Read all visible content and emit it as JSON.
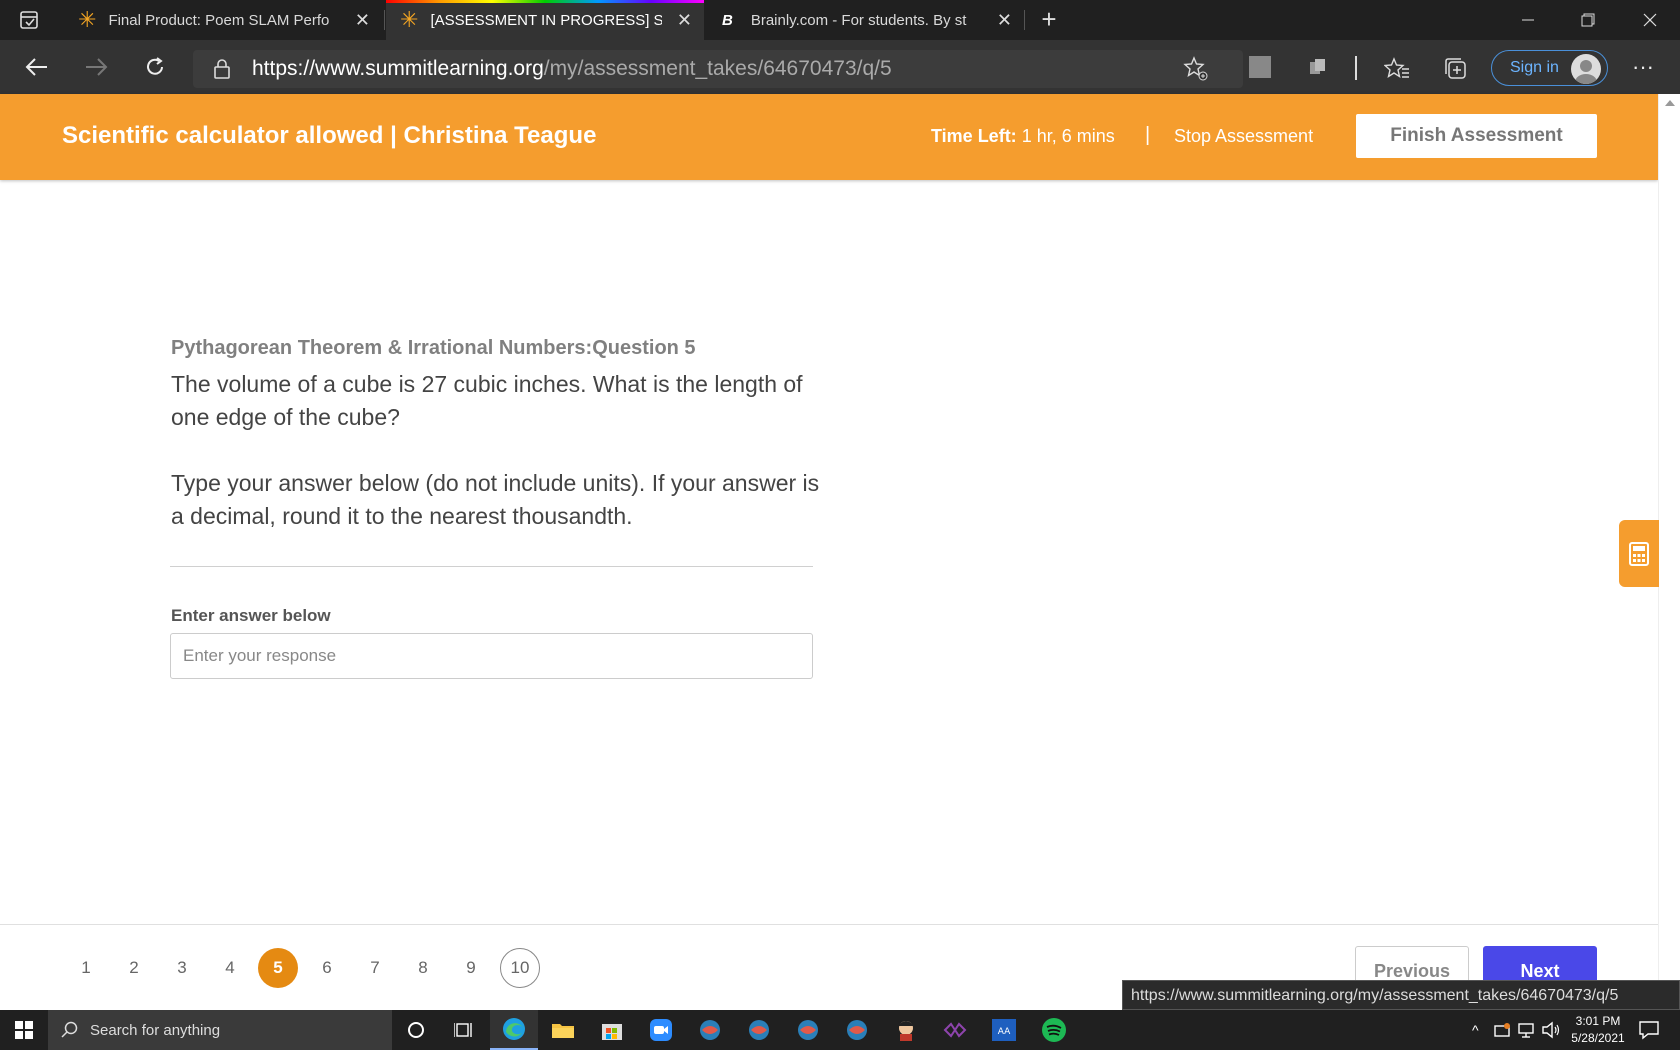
{
  "browser": {
    "tabs": [
      {
        "title": "Final Product: Poem SLAM Perfo",
        "active": false
      },
      {
        "title": "[ASSESSMENT IN PROGRESS] Su",
        "active": true
      },
      {
        "title": "Brainly.com - For students. By st",
        "active": false
      }
    ],
    "url_host": "https://www.summitlearning.org",
    "url_path": "/my/assessment_takes/64670473/q/5",
    "signin_label": "Sign in",
    "status_url": "https://www.summitlearning.org/my/assessment_takes/64670473/q/5"
  },
  "header": {
    "title": "Scientific calculator allowed | Christina Teague",
    "time_left_label": "Time Left:",
    "time_left_value": " 1 hr, 6 mins",
    "separator": "|",
    "stop_label": "Stop Assessment",
    "finish_label": "Finish Assessment",
    "accent_color": "#f59d2e"
  },
  "question": {
    "heading": "Pythagorean Theorem & Irrational Numbers:Question 5",
    "prompt": "The volume of a cube is 27 cubic inches. What is the length of one edge of the cube?",
    "instructions": "Type your answer below (do not include units). If your answer is a decimal, round it to the nearest thousandth.",
    "answer_label": "Enter answer below",
    "answer_placeholder": "Enter your response",
    "answer_value": ""
  },
  "pagination": {
    "items": [
      "1",
      "2",
      "3",
      "4",
      "5",
      "6",
      "7",
      "8",
      "9",
      "10"
    ],
    "current": "5",
    "previous_label": "Previous",
    "next_label": "Next"
  },
  "taskbar": {
    "search_placeholder": "Search for anything",
    "time": "3:01 PM",
    "date": "5/28/2021"
  }
}
